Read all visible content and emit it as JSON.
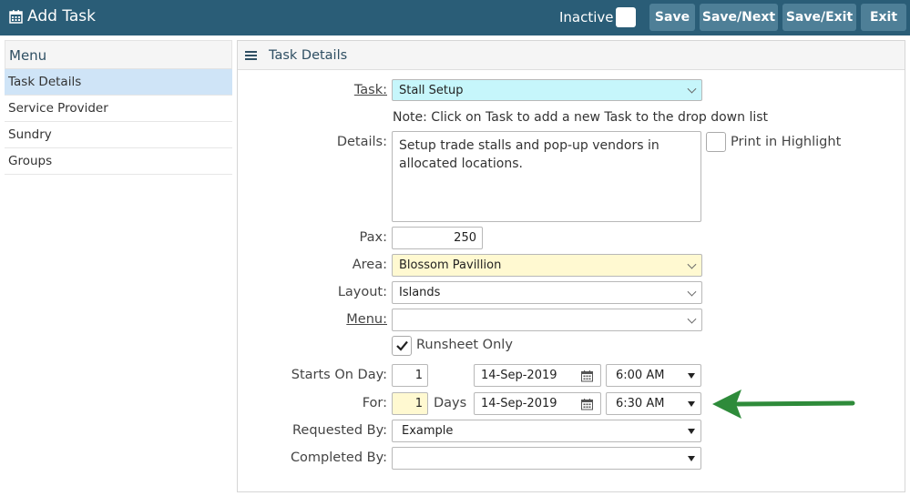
{
  "header": {
    "title": "Add Task",
    "title_icon": "calendar-icon",
    "inactive_label": "Inactive",
    "inactive_checked": false,
    "buttons": {
      "save": "Save",
      "save_next": "Save/Next",
      "save_exit": "Save/Exit",
      "exit": "Exit"
    }
  },
  "sidebar": {
    "heading": "Menu",
    "items": [
      {
        "label": "Task Details",
        "active": true
      },
      {
        "label": "Service Provider",
        "active": false
      },
      {
        "label": "Sundry",
        "active": false
      },
      {
        "label": "Groups",
        "active": false
      }
    ]
  },
  "panel": {
    "title": "Task Details",
    "task": {
      "label": "Task:",
      "value": "Stall Setup"
    },
    "note": "Note: Click on Task to add a new Task to the drop down list",
    "details": {
      "label": "Details:",
      "value": "Setup trade stalls and pop-up vendors in allocated locations."
    },
    "print_highlight": {
      "label": "Print in Highlight",
      "checked": false
    },
    "pax": {
      "label": "Pax:",
      "value": "250"
    },
    "area": {
      "label": "Area:",
      "value": "Blossom Pavillion"
    },
    "layout": {
      "label": "Layout:",
      "value": "Islands"
    },
    "menu": {
      "label": "Menu:",
      "value": ""
    },
    "runsheet": {
      "label": "Runsheet Only",
      "checked": true
    },
    "starts_on_day": {
      "label": "Starts On Day:",
      "day": "1",
      "date": "14-Sep-2019",
      "time": "6:00 AM"
    },
    "for": {
      "label": "For:",
      "value": "1",
      "unit": "Days",
      "date": "14-Sep-2019",
      "time": "6:30 AM"
    },
    "requested_by": {
      "label": "Requested By:",
      "value": "Example"
    },
    "completed_by": {
      "label": "Completed By:",
      "value": ""
    }
  },
  "colors": {
    "header_bg": "#2a5d77",
    "button_bg": "#4e7f97",
    "arrow": "#2e8b3a",
    "active_menu": "#cfe4f7"
  }
}
